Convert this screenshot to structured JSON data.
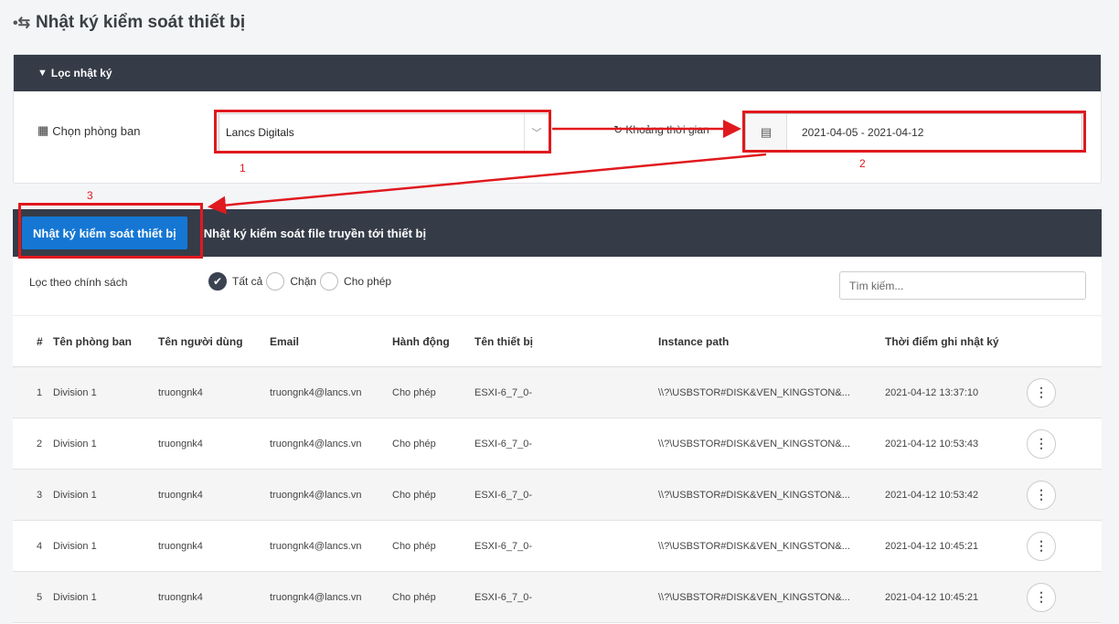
{
  "page": {
    "title": "Nhật ký kiểm soát thiết bị"
  },
  "filter": {
    "header": "Lọc nhật ký",
    "department_label": "Chọn phòng ban",
    "department_value": "Lancs Digitals",
    "time_label": "Khoảng thời gian",
    "date_range": "2021-04-05 - 2021-04-12"
  },
  "annotations": [
    "1",
    "2",
    "3"
  ],
  "tabs": [
    {
      "label": "Nhật ký kiểm soát thiết bị",
      "active": true
    },
    {
      "label": "Nhật ký kiểm soát file truyền tới thiết bị",
      "active": false
    }
  ],
  "policy": {
    "label": "Lọc theo chính sách",
    "options": [
      "Tất cả",
      "Chặn",
      "Cho phép"
    ],
    "selected": "Tất cả"
  },
  "search": {
    "placeholder": "Tìm kiếm..."
  },
  "table": {
    "headers": [
      "#",
      "Tên phòng ban",
      "Tên người dùng",
      "Email",
      "Hành động",
      "Tên thiết bị",
      "Instance path",
      "Thời điểm ghi nhật ký"
    ],
    "rows": [
      [
        "1",
        "Division 1",
        "truongnk4",
        "truongnk4@lancs.vn",
        "Cho phép",
        "ESXI-6_7_0-",
        "\\\\?\\USBSTOR#DISK&VEN_KINGSTON&...",
        "2021-04-12 13:37:10"
      ],
      [
        "2",
        "Division 1",
        "truongnk4",
        "truongnk4@lancs.vn",
        "Cho phép",
        "ESXI-6_7_0-",
        "\\\\?\\USBSTOR#DISK&VEN_KINGSTON&...",
        "2021-04-12 10:53:43"
      ],
      [
        "3",
        "Division 1",
        "truongnk4",
        "truongnk4@lancs.vn",
        "Cho phép",
        "ESXI-6_7_0-",
        "\\\\?\\USBSTOR#DISK&VEN_KINGSTON&...",
        "2021-04-12 10:53:42"
      ],
      [
        "4",
        "Division 1",
        "truongnk4",
        "truongnk4@lancs.vn",
        "Cho phép",
        "ESXI-6_7_0-",
        "\\\\?\\USBSTOR#DISK&VEN_KINGSTON&...",
        "2021-04-12 10:45:21"
      ],
      [
        "5",
        "Division 1",
        "truongnk4",
        "truongnk4@lancs.vn",
        "Cho phép",
        "ESXI-6_7_0-",
        "\\\\?\\USBSTOR#DISK&VEN_KINGSTON&...",
        "2021-04-12 10:45:21"
      ]
    ],
    "row_action_icon": "more-vertical-icon"
  },
  "colors": {
    "header_bg": "#353c48",
    "tab_active_bg": "#1577d3",
    "annotation": "#e0191e"
  }
}
